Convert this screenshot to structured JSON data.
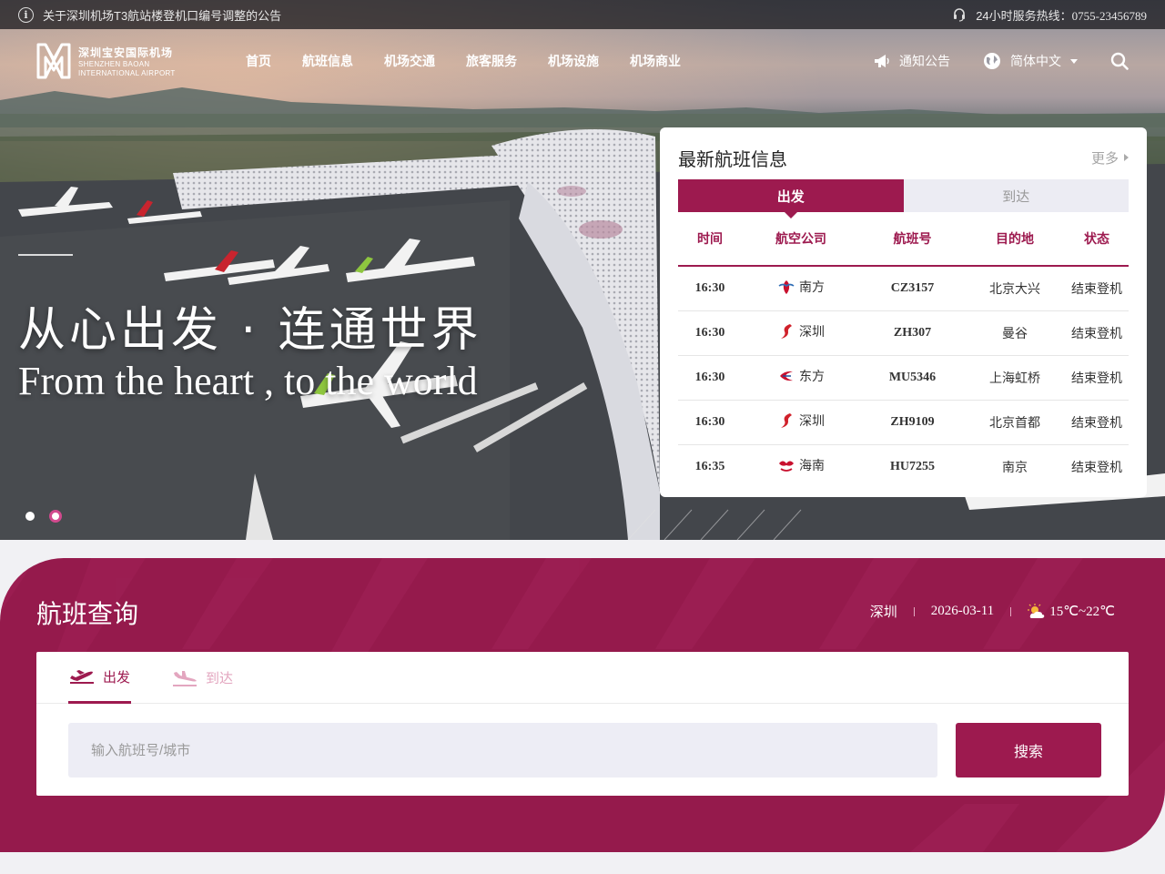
{
  "notice": {
    "text": "关于深圳机场T3航站楼登机口编号调整的公告",
    "hotline_label": "24小时服务热线：",
    "hotline_number": "0755-23456789"
  },
  "logo": {
    "name_cn": "深圳宝安国际机场",
    "name_en_1": "SHENZHEN BAOAN",
    "name_en_2": "INTERNATIONAL AIRPORT"
  },
  "nav": {
    "items": [
      "首页",
      "航班信息",
      "机场交通",
      "旅客服务",
      "机场设施",
      "机场商业"
    ],
    "notice_label": "通知公告",
    "language_label": "简体中文"
  },
  "hero": {
    "slogan_cn": "从心出发 · 连通世界",
    "slogan_en": "From the heart , to the world"
  },
  "flight_panel": {
    "title": "最新航班信息",
    "more_label": "更多",
    "tabs": [
      "出发",
      "到达"
    ],
    "columns": [
      "时间",
      "航空公司",
      "航班号",
      "目的地",
      "状态"
    ],
    "rows": [
      {
        "time": "16:30",
        "airline": "南方",
        "airline_icon": "china-southern-logo-icon",
        "flight": "CZ3157",
        "dest": "北京大兴",
        "status": "结束登机"
      },
      {
        "time": "16:30",
        "airline": "深圳",
        "airline_icon": "shenzhen-airlines-logo-icon",
        "flight": "ZH307",
        "dest": "曼谷",
        "status": "结束登机"
      },
      {
        "time": "16:30",
        "airline": "东方",
        "airline_icon": "china-eastern-logo-icon",
        "flight": "MU5346",
        "dest": "上海虹桥",
        "status": "结束登机"
      },
      {
        "time": "16:30",
        "airline": "深圳",
        "airline_icon": "shenzhen-airlines-logo-icon",
        "flight": "ZH9109",
        "dest": "北京首都",
        "status": "结束登机"
      },
      {
        "time": "16:35",
        "airline": "海南",
        "airline_icon": "hainan-airlines-logo-icon",
        "flight": "HU7255",
        "dest": "南京",
        "status": "结束登机"
      }
    ]
  },
  "search": {
    "title": "航班查询",
    "city": "深圳",
    "date": "2026-03-11",
    "temperature": "15℃~22℃",
    "tabs": [
      "出发",
      "到达"
    ],
    "placeholder": "输入航班号/城市",
    "button_label": "搜索"
  },
  "colors": {
    "brand": "#9d1a4f",
    "brand_dark": "#951a4c",
    "tab_inactive_bg": "#ececf3"
  }
}
